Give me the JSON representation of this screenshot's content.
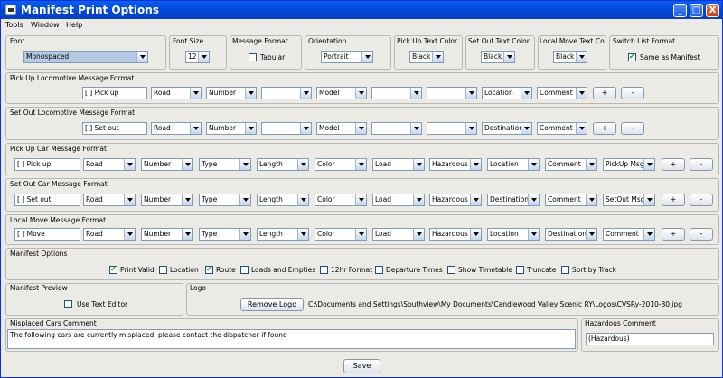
{
  "window": {
    "title": "Manifest Print Options",
    "min": "_",
    "max": "□",
    "close": "X"
  },
  "menu": [
    "Tools",
    "Window",
    "Help"
  ],
  "top": {
    "font": {
      "label": "Font",
      "value": "Monospaced"
    },
    "font_size": {
      "label": "Font Size",
      "value": "12"
    },
    "message_format": {
      "label": "Message Format",
      "checkbox": "Tabular"
    },
    "orientation": {
      "label": "Orientation",
      "value": "Portrait"
    },
    "pickup_color": {
      "label": "Pick Up Text Color",
      "value": "Black"
    },
    "setout_color": {
      "label": "Set Out Text Color",
      "value": "Black"
    },
    "localmove_color": {
      "label": "Local Move Text Colc",
      "value": "Black"
    },
    "switch_list": {
      "label": "Switch List Format",
      "checkbox": "Same as Manifest"
    }
  },
  "sections": [
    {
      "title": "Pick Up Locomotive Message Format",
      "prefix": "[ ] Pick up",
      "combos": [
        "Road",
        "Number",
        "",
        "Model",
        "",
        "",
        "Location",
        "Comment"
      ]
    },
    {
      "title": "Set Out Locomotive Message Format",
      "prefix": "[ ] Set out",
      "combos": [
        "Road",
        "Number",
        "",
        "Model",
        "",
        "",
        "Destination",
        "Comment"
      ]
    },
    {
      "title": "Pick Up Car Message Format",
      "prefix": "[ ] Pick up",
      "combos": [
        "Road",
        "Number",
        "Type",
        "Length",
        "Color",
        "Load",
        "Hazardous",
        "Location",
        "Comment",
        "PickUp Msg"
      ]
    },
    {
      "title": "Set Out Car Message Format",
      "prefix": "[ ] Set out",
      "combos": [
        "Road",
        "Number",
        "Type",
        "Length",
        "Color",
        "Load",
        "Hazardous",
        "Destination",
        "Comment",
        "SetOut Msg"
      ]
    },
    {
      "title": "Local Move Message Format",
      "prefix": "[ ] Move",
      "combos": [
        "Road",
        "Number",
        "Type",
        "Length",
        "Color",
        "Load",
        "Hazardous",
        "Location",
        "Destination",
        "Comment"
      ]
    }
  ],
  "plus": "+",
  "minus": "-",
  "manifest_options": {
    "title": "Manifest Options",
    "items": [
      {
        "label": "Print Valid",
        "checked": true
      },
      {
        "label": "Location",
        "checked": false
      },
      {
        "label": "Route",
        "checked": true
      },
      {
        "label": "Loads and Empties",
        "checked": false
      },
      {
        "label": "12hr Format",
        "checked": false
      },
      {
        "label": "Departure Times",
        "checked": false
      },
      {
        "label": "Show Timetable",
        "checked": false
      },
      {
        "label": "Truncate",
        "checked": false
      },
      {
        "label": "Sort by Track",
        "checked": false
      }
    ]
  },
  "preview": {
    "title": "Manifest Preview",
    "checkbox": "Use Text Editor"
  },
  "logo": {
    "title": "Logo",
    "button": "Remove Logo",
    "path": "C:\\Documents and Settings\\Southview\\My Documents\\Candlewood Valley Scenic RY\\Logos\\CVSRy-2010-80.jpg"
  },
  "misplaced": {
    "title": "Misplaced Cars Comment",
    "value": "The following cars are currently misplaced, please contact the dispatcher if found"
  },
  "hazardous": {
    "title": "Hazardous Comment",
    "value": "(Hazardous)"
  },
  "save": "Save"
}
